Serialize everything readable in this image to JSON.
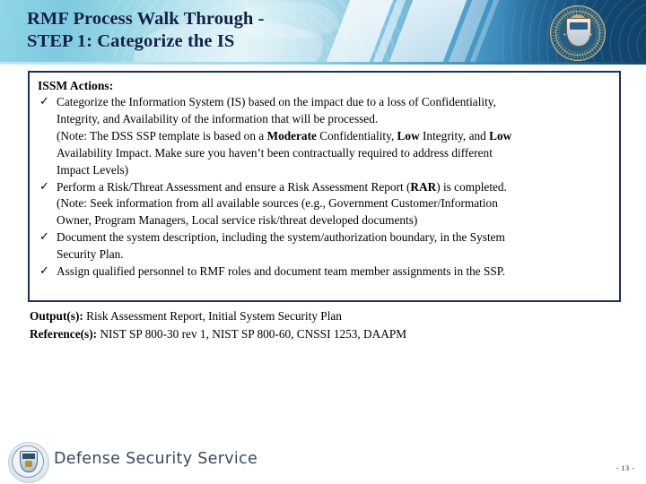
{
  "header": {
    "title": "RMF Process Walk Through -\nSTEP 1:  Categorize the IS",
    "seal_name": "defense-security-service-seal"
  },
  "box": {
    "heading": "ISSM Actions:",
    "bullet_glyph": "✓",
    "bullets": [
      {
        "lines": [
          {
            "parts": [
              {
                "t": "Categorize the Information System (IS) based on the impact due to a loss of Confidentiality,",
                "b": false
              }
            ]
          },
          {
            "parts": [
              {
                "t": "Integrity, and Availability of the information that will be processed.",
                "b": false
              }
            ]
          },
          {
            "parts": [
              {
                "t": "(Note:  The DSS SSP template is based on a ",
                "b": false
              },
              {
                "t": "Moderate",
                "b": true
              },
              {
                "t": " Confidentiality, ",
                "b": false
              },
              {
                "t": "Low",
                "b": true
              },
              {
                "t": " Integrity, and ",
                "b": false
              },
              {
                "t": "Low",
                "b": true
              }
            ]
          },
          {
            "parts": [
              {
                "t": "Availability Impact.  Make sure you haven’t been contractually required to address different",
                "b": false
              }
            ]
          },
          {
            "parts": [
              {
                "t": "Impact Levels)",
                "b": false
              }
            ]
          }
        ]
      },
      {
        "lines": [
          {
            "parts": [
              {
                "t": "Perform a Risk/Threat Assessment and ensure a Risk Assessment Report (",
                "b": false
              },
              {
                "t": "RAR",
                "b": true
              },
              {
                "t": ") is completed.",
                "b": false
              }
            ]
          },
          {
            "parts": [
              {
                "t": "(Note:  Seek information from all available sources (e.g., Government Customer/Information",
                "b": false
              }
            ]
          },
          {
            "parts": [
              {
                "t": "Owner, Program Managers, Local service risk/threat developed documents)",
                "b": false
              }
            ]
          }
        ]
      },
      {
        "lines": [
          {
            "parts": [
              {
                "t": "Document the system description, including the system/authorization boundary, in the System",
                "b": false
              }
            ]
          },
          {
            "parts": [
              {
                "t": "Security Plan.",
                "b": false
              }
            ]
          }
        ]
      },
      {
        "lines": [
          {
            "parts": [
              {
                "t": "Assign qualified personnel to RMF roles and document team member assignments in the SSP.",
                "b": false
              }
            ]
          }
        ]
      }
    ]
  },
  "outputs": {
    "output_label": "Output(s):",
    "output_value": " Risk Assessment Report, Initial System Security Plan",
    "reference_label": "Reference(s):",
    "reference_value": " NIST SP 800-30 rev 1,  NIST SP 800-60,  CNSSI 1253, DAAPM"
  },
  "footer": {
    "brand": "Defense Security Service",
    "logo_name": "dss-shield-logo",
    "page_number": "- 13 -"
  },
  "colors": {
    "title_navy": "#11204a",
    "box_border": "#1b2f63",
    "banner_light": "#8fd6e8",
    "banner_dark": "#16466a",
    "footer_text": "#3b4a5a"
  }
}
